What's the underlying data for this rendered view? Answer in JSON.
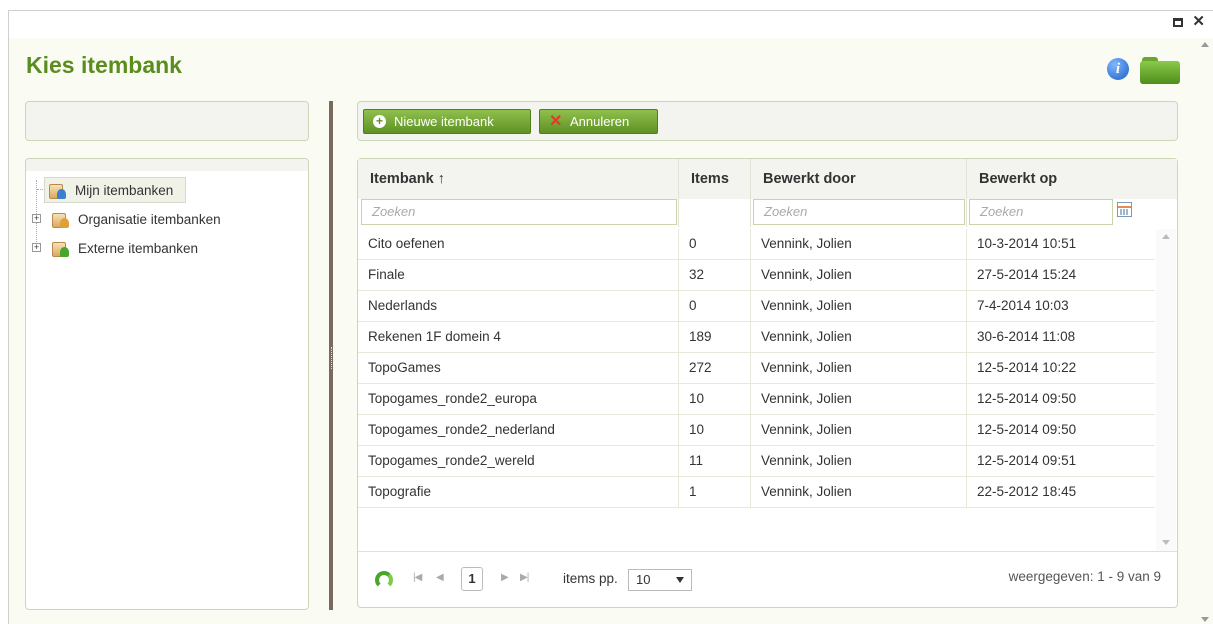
{
  "window": {
    "maximize_label": "",
    "close_label": "✕"
  },
  "title": "Kies itembank",
  "info_icon_glyph": "i",
  "tree": {
    "items": [
      {
        "label": "Mijn itembanken",
        "icon": "personal-bank-icon",
        "selected": true
      },
      {
        "label": "Organisatie itembanken",
        "icon": "organisation-bank-icon",
        "selected": false
      },
      {
        "label": "Externe itembanken",
        "icon": "external-bank-icon",
        "selected": false
      }
    ]
  },
  "toolbar": {
    "new_label": "Nieuwe itembank",
    "cancel_label": "Annuleren"
  },
  "grid": {
    "columns": [
      {
        "key": "name",
        "label": "Itembank ↑"
      },
      {
        "key": "items",
        "label": "Items"
      },
      {
        "key": "by",
        "label": "Bewerkt door"
      },
      {
        "key": "on",
        "label": "Bewerkt op"
      }
    ],
    "filters": {
      "name_placeholder": "Zoeken",
      "by_placeholder": "Zoeken",
      "on_placeholder": "Zoeken"
    },
    "rows": [
      {
        "name": "Cito oefenen",
        "items": "0",
        "by": "Vennink, Jolien",
        "on": "10-3-2014 10:51"
      },
      {
        "name": "Finale",
        "items": "32",
        "by": "Vennink, Jolien",
        "on": "27-5-2014 15:24"
      },
      {
        "name": "Nederlands",
        "items": "0",
        "by": "Vennink, Jolien",
        "on": "7-4-2014 10:03"
      },
      {
        "name": "Rekenen 1F domein 4",
        "items": "189",
        "by": "Vennink, Jolien",
        "on": "30-6-2014 11:08"
      },
      {
        "name": "TopoGames",
        "items": "272",
        "by": "Vennink, Jolien",
        "on": "12-5-2014 10:22"
      },
      {
        "name": "Topogames_ronde2_europa",
        "items": "10",
        "by": "Vennink, Jolien",
        "on": "12-5-2014 09:50"
      },
      {
        "name": "Topogames_ronde2_nederland",
        "items": "10",
        "by": "Vennink, Jolien",
        "on": "12-5-2014 09:50"
      },
      {
        "name": "Topogames_ronde2_wereld",
        "items": "11",
        "by": "Vennink, Jolien",
        "on": "12-5-2014 09:51"
      },
      {
        "name": "Topografie",
        "items": "1",
        "by": "Vennink, Jolien",
        "on": "22-5-2012 18:45"
      }
    ]
  },
  "pager": {
    "first": "|◀",
    "prev": "◀",
    "current_page": "1",
    "next": "▶",
    "last": "▶|",
    "items_pp_label": "items pp.",
    "items_pp_value": "10",
    "info": "weergegeven: 1 - 9 van 9"
  },
  "colors": {
    "title_green": "#5b8d1e",
    "button_green": "#6fa12f",
    "splitter_brown": "#7a6a5e"
  }
}
